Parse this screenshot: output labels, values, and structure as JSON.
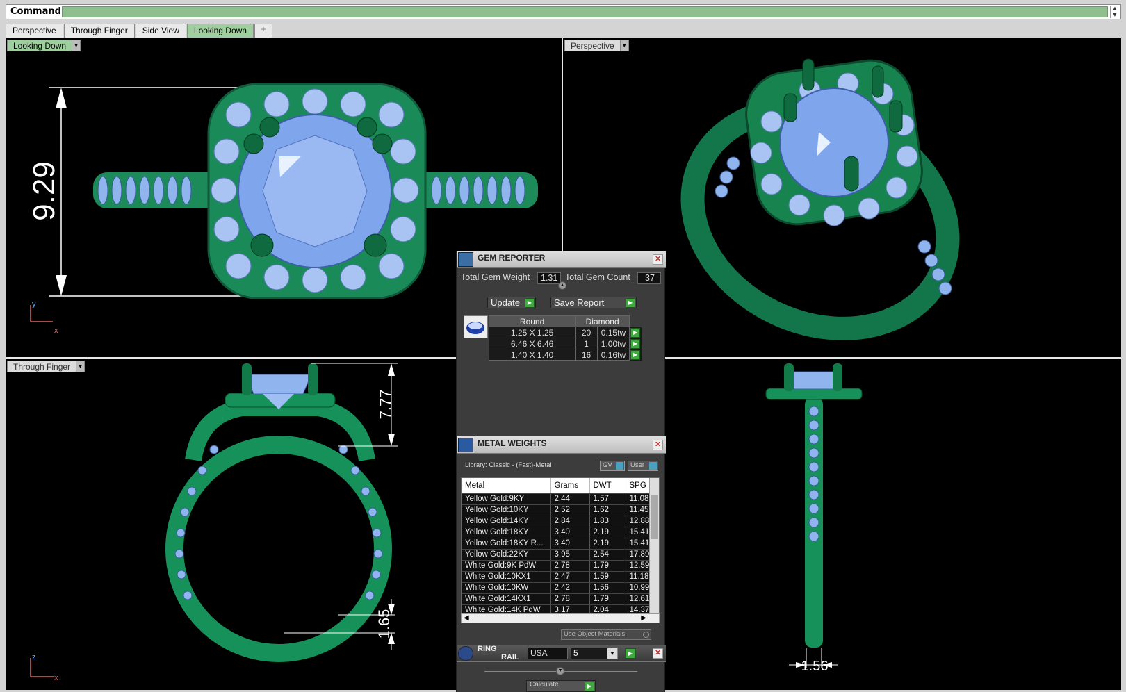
{
  "command": {
    "label": "Command:",
    "value": ""
  },
  "tabs": [
    {
      "label": "Perspective",
      "active": false
    },
    {
      "label": "Through Finger",
      "active": false
    },
    {
      "label": "Side View",
      "active": false
    },
    {
      "label": "Looking Down",
      "active": true
    },
    {
      "label": "+",
      "active": false
    }
  ],
  "viewports": {
    "top_left": {
      "label": "Looking Down",
      "dimension": "9.29",
      "axis_y": "y",
      "axis_x": "x"
    },
    "top_right": {
      "label": "Perspective"
    },
    "bottom_left": {
      "label": "Through Finger",
      "dimension_height": "7.77",
      "dimension_shank": "1.65",
      "axis_y": "z",
      "axis_x": "x"
    },
    "bottom_right": {
      "dimension_width": "1.56"
    }
  },
  "gem_reporter": {
    "title": "GEM REPORTER",
    "total_weight_label": "Total Gem Weight",
    "total_weight": "1.31",
    "total_count_label": "Total Gem Count",
    "total_count": "37",
    "update_label": "Update",
    "save_label": "Save Report",
    "headers": [
      "Round",
      "Diamond"
    ],
    "rows": [
      {
        "size": "1.25 X 1.25",
        "count": "20",
        "weight": "0.15tw"
      },
      {
        "size": "6.46 X 6.46",
        "count": "1",
        "weight": "1.00tw"
      },
      {
        "size": "1.40 X 1.40",
        "count": "16",
        "weight": "0.16tw"
      }
    ]
  },
  "metal_weights": {
    "title": "METAL WEIGHTS",
    "library": "Library: Classic - (Fast)-Metal",
    "gv_label": "GV",
    "user_label": "User",
    "columns": [
      "Metal",
      "Grams",
      "DWT",
      "SPG"
    ],
    "rows": [
      {
        "metal": "Yellow Gold:9KY",
        "grams": "2.44",
        "dwt": "1.57",
        "spg": "11.08"
      },
      {
        "metal": "Yellow Gold:10KY",
        "grams": "2.52",
        "dwt": "1.62",
        "spg": "11.45"
      },
      {
        "metal": "Yellow Gold:14KY",
        "grams": "2.84",
        "dwt": "1.83",
        "spg": "12.88"
      },
      {
        "metal": "Yellow Gold:18KY",
        "grams": "3.40",
        "dwt": "2.19",
        "spg": "15.41"
      },
      {
        "metal": "Yellow Gold:18KY R...",
        "grams": "3.40",
        "dwt": "2.19",
        "spg": "15.41"
      },
      {
        "metal": "Yellow Gold:22KY",
        "grams": "3.95",
        "dwt": "2.54",
        "spg": "17.89"
      },
      {
        "metal": "White Gold:9K PdW",
        "grams": "2.78",
        "dwt": "1.79",
        "spg": "12.59"
      },
      {
        "metal": "White Gold:10KX1",
        "grams": "2.47",
        "dwt": "1.59",
        "spg": "11.18"
      },
      {
        "metal": "White Gold:10KW",
        "grams": "2.42",
        "dwt": "1.56",
        "spg": "10.99"
      },
      {
        "metal": "White Gold:14KX1",
        "grams": "2.78",
        "dwt": "1.79",
        "spg": "12.61"
      },
      {
        "metal": "White Gold:14K PdW",
        "grams": "3.17",
        "dwt": "2.04",
        "spg": "14.37"
      }
    ],
    "use_object_materials": "Use Object Materials"
  },
  "ring_rail": {
    "title_line1": "RING",
    "title_line2": "RAIL",
    "region": "USA",
    "size": "5",
    "calculate_label": "Calculate"
  },
  "colors": {
    "metal": "#1a8a5a",
    "gem": "#8fb4ee",
    "active_tab": "#9fcf9f"
  }
}
